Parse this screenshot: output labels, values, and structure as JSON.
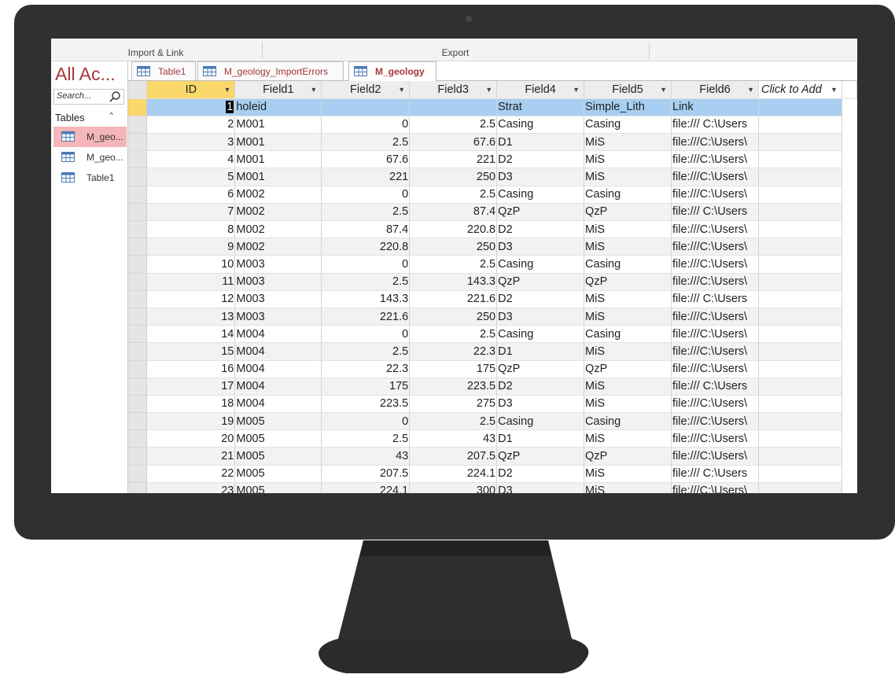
{
  "ribbon": {
    "group_import": "Import & Link",
    "group_export": "Export"
  },
  "nav": {
    "title": "All Ac...",
    "search_placeholder": "Search...",
    "section": "Tables",
    "items": [
      {
        "label": "M_geo...",
        "active": true
      },
      {
        "label": "M_geo...",
        "active": false
      },
      {
        "label": "Table1",
        "active": false
      }
    ]
  },
  "tabs": [
    {
      "label": "Table1",
      "active": false
    },
    {
      "label": "M_geology_ImportErrors",
      "active": false
    },
    {
      "label": "M_geology",
      "active": true
    }
  ],
  "columns": [
    "ID",
    "Field1",
    "Field2",
    "Field3",
    "Field4",
    "Field5",
    "Field6",
    "Click to Add"
  ],
  "rows": [
    [
      "1",
      "holeid",
      "",
      "",
      "Strat",
      "Simple_Lith",
      "Link"
    ],
    [
      "2",
      "M001",
      "0",
      "2.5",
      "Casing",
      "Casing",
      "file:/// C:\\Users"
    ],
    [
      "3",
      "M001",
      "2.5",
      "67.6",
      "D1",
      "MiS",
      "file:///C:\\Users\\"
    ],
    [
      "4",
      "M001",
      "67.6",
      "221",
      "D2",
      "MiS",
      "file:///C:\\Users\\"
    ],
    [
      "5",
      "M001",
      "221",
      "250",
      "D3",
      "MiS",
      "file:///C:\\Users\\"
    ],
    [
      "6",
      "M002",
      "0",
      "2.5",
      "Casing",
      "Casing",
      "file:///C:\\Users\\"
    ],
    [
      "7",
      "M002",
      "2.5",
      "87.4",
      "QzP",
      "QzP",
      "file:/// C:\\Users"
    ],
    [
      "8",
      "M002",
      "87.4",
      "220.8",
      "D2",
      "MiS",
      "file:///C:\\Users\\"
    ],
    [
      "9",
      "M002",
      "220.8",
      "250",
      "D3",
      "MiS",
      "file:///C:\\Users\\"
    ],
    [
      "10",
      "M003",
      "0",
      "2.5",
      "Casing",
      "Casing",
      "file:///C:\\Users\\"
    ],
    [
      "11",
      "M003",
      "2.5",
      "143.3",
      "QzP",
      "QzP",
      "file:///C:\\Users\\"
    ],
    [
      "12",
      "M003",
      "143.3",
      "221.6",
      "D2",
      "MiS",
      "file:/// C:\\Users"
    ],
    [
      "13",
      "M003",
      "221.6",
      "250",
      "D3",
      "MiS",
      "file:///C:\\Users\\"
    ],
    [
      "14",
      "M004",
      "0",
      "2.5",
      "Casing",
      "Casing",
      "file:///C:\\Users\\"
    ],
    [
      "15",
      "M004",
      "2.5",
      "22.3",
      "D1",
      "MiS",
      "file:///C:\\Users\\"
    ],
    [
      "16",
      "M004",
      "22.3",
      "175",
      "QzP",
      "QzP",
      "file:///C:\\Users\\"
    ],
    [
      "17",
      "M004",
      "175",
      "223.5",
      "D2",
      "MiS",
      "file:/// C:\\Users"
    ],
    [
      "18",
      "M004",
      "223.5",
      "275",
      "D3",
      "MiS",
      "file:///C:\\Users\\"
    ],
    [
      "19",
      "M005",
      "0",
      "2.5",
      "Casing",
      "Casing",
      "file:///C:\\Users\\"
    ],
    [
      "20",
      "M005",
      "2.5",
      "43",
      "D1",
      "MiS",
      "file:///C:\\Users\\"
    ],
    [
      "21",
      "M005",
      "43",
      "207.5",
      "QzP",
      "QzP",
      "file:///C:\\Users\\"
    ],
    [
      "22",
      "M005",
      "207.5",
      "224.1",
      "D2",
      "MiS",
      "file:/// C:\\Users"
    ],
    [
      "23",
      "M005",
      "224.1",
      "300",
      "D3",
      "MiS",
      "file:///C:\\Users\\"
    ]
  ],
  "colors": {
    "access_accent": "#a4373a",
    "header_active": "#fbd86b",
    "row_selected": "#a8cff2",
    "monitor": "#303030"
  }
}
